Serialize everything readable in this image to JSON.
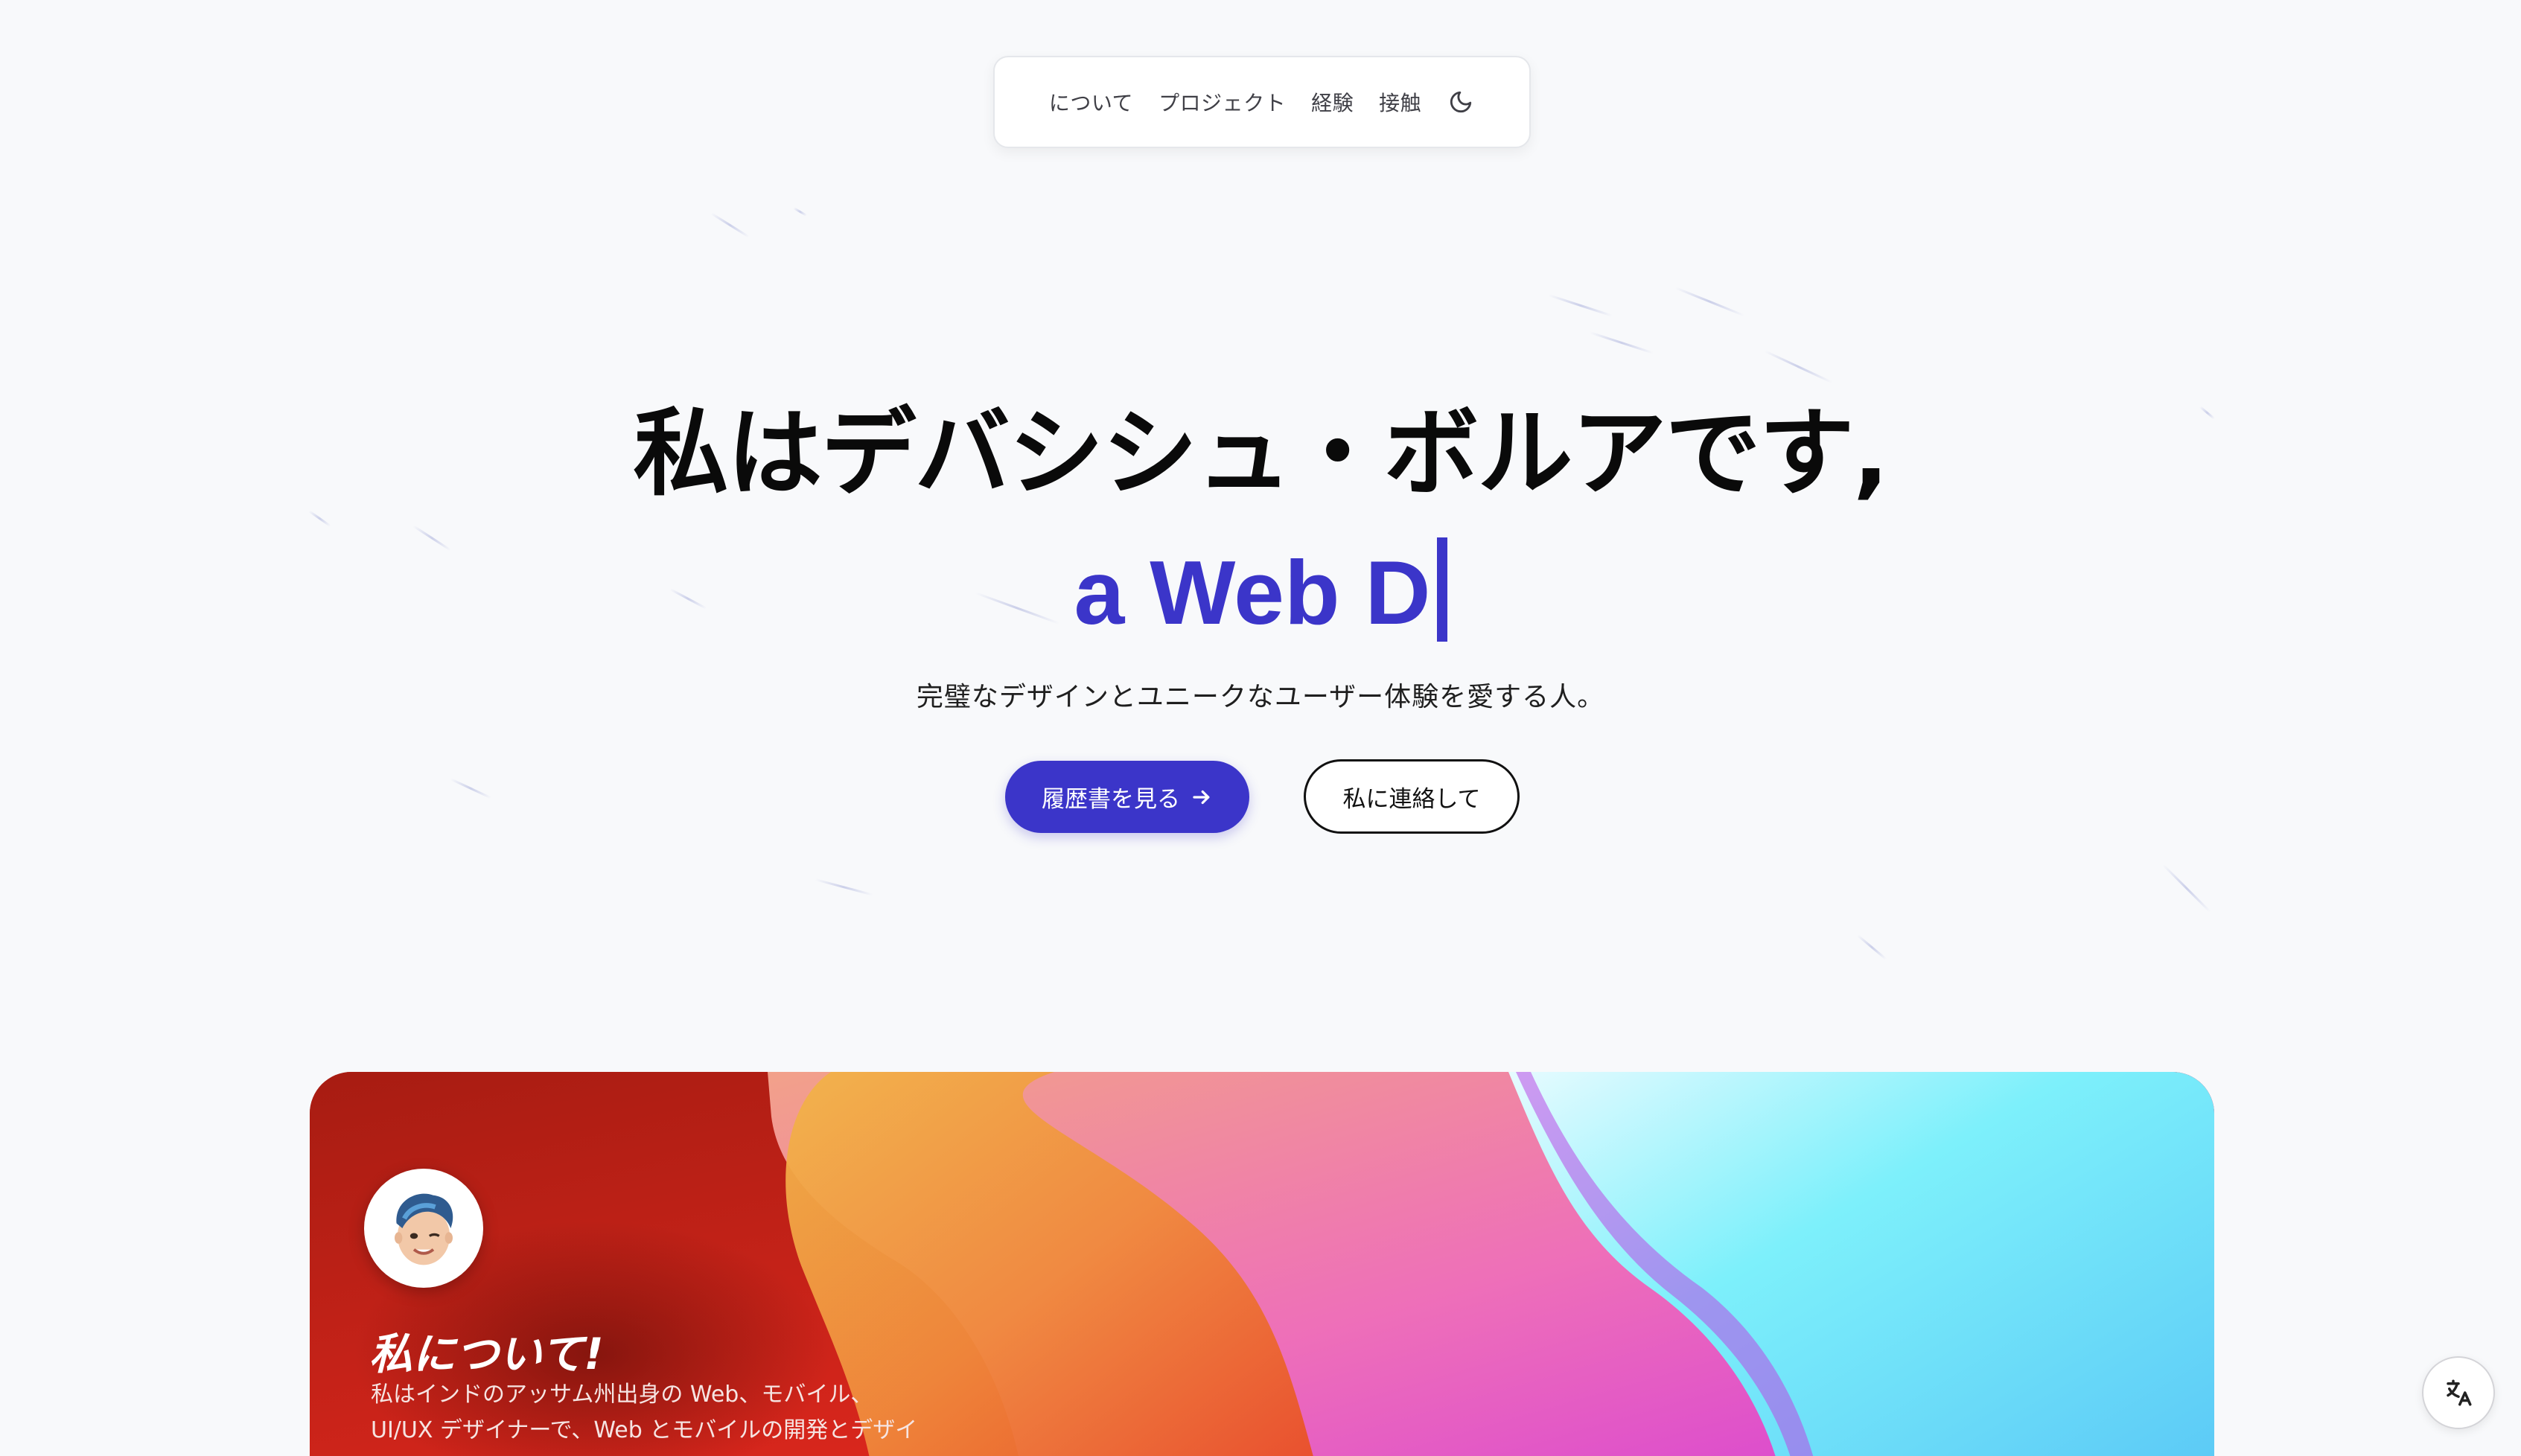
{
  "nav": {
    "items": [
      {
        "label": "について"
      },
      {
        "label": "プロジェクト"
      },
      {
        "label": "経験"
      },
      {
        "label": "接触"
      }
    ],
    "theme_toggle_icon": "moon-icon"
  },
  "hero": {
    "title": "私はデバシシュ・ボルアです,",
    "typed_text": "a Web D",
    "subtitle": "完璧なデザインとユニークなユーザー体験を愛する人。",
    "primary_button": "履歴書を見る",
    "primary_button_icon": "arrow-right-icon",
    "secondary_button": "私に連絡して"
  },
  "about": {
    "title": "私について!",
    "text_lines": [
      "私はインドのアッサム州出身の Web、モバイル、",
      "UI/UX デザイナーで、Web とモバイルの開発とデザイ"
    ],
    "avatar_icon": "memoji-avatar"
  },
  "floating": {
    "translate_icon": "translate-icon"
  },
  "colors": {
    "accent": "#3b35c9",
    "background": "#f8f9fb"
  }
}
